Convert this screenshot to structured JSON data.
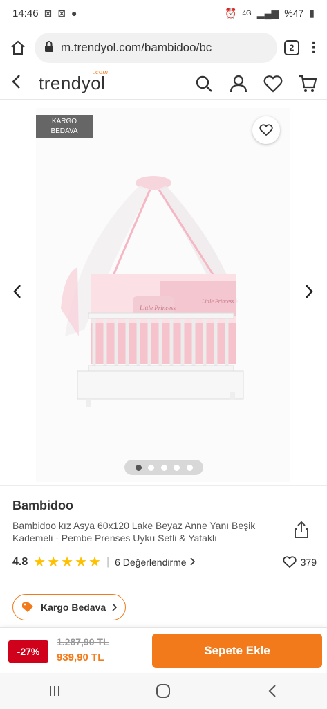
{
  "status_bar": {
    "time": "14:46",
    "network": "4G",
    "battery": "%47"
  },
  "browser": {
    "url": "m.trendyol.com/bambidoo/bc",
    "tab_count": "2"
  },
  "header": {
    "logo": "trendyol",
    "logo_suffix": ".com"
  },
  "gallery": {
    "tag_line1": "KARGO",
    "tag_line2": "BEDAVA",
    "image_count": 5,
    "active_index": 0,
    "crib_inner_text": "Little Princess",
    "crib_bumper_text": "Little Princess"
  },
  "product": {
    "brand": "Bambidoo",
    "title": "Bambidoo kız Asya 60x120 Lake Beyaz Anne Yanı Beşik Kademeli - Pembe Prenses Uyku Setli & Yataklı",
    "rating": "4.8",
    "star_count": 5,
    "reviews_label": "6 Değerlendirme",
    "likes": "379"
  },
  "shipping_pill": {
    "label": "Kargo Bedava"
  },
  "buy_bar": {
    "discount": "-27%",
    "old_price": "1.287,90 TL",
    "new_price": "939,90 TL",
    "cart_label": "Sepete Ekle"
  },
  "colors": {
    "brand_orange": "#f27a1a",
    "discount_red": "#d0021b",
    "star_yellow": "#ffc000"
  }
}
